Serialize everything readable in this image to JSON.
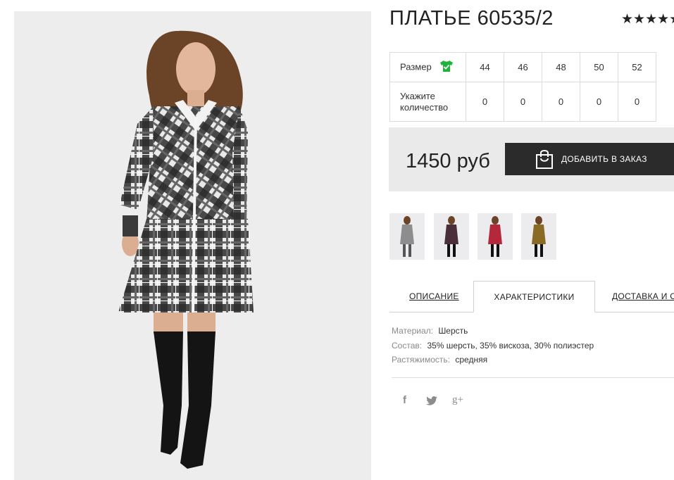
{
  "product": {
    "title": "ПЛАТЬЕ 60535/2",
    "rating_stars": "★★★★★",
    "price": "1450 руб",
    "add_button_label": "ДОБАВИТЬ В ЗАКАЗ"
  },
  "size_table": {
    "size_label": "Размер",
    "qty_label_line1": "Укажите",
    "qty_label_line2": "количество",
    "sizes": [
      "44",
      "46",
      "48",
      "50",
      "52"
    ],
    "quantities": [
      "0",
      "0",
      "0",
      "0",
      "0"
    ]
  },
  "thumbnails": [
    {
      "name": "grey-plaid",
      "color": "#8d8d8d"
    },
    {
      "name": "dark-plaid",
      "color": "#4a2f3a"
    },
    {
      "name": "red-plaid",
      "color": "#b5283c"
    },
    {
      "name": "mustard-plaid",
      "color": "#8a6a25"
    }
  ],
  "tabs": [
    {
      "label": "ОПИСАНИЕ"
    },
    {
      "label": "ХАРАКТЕРИСТИКИ"
    },
    {
      "label": "ДОСТАВКА И ОПЛАТА"
    }
  ],
  "specs": [
    {
      "key": "Материал:",
      "value": "Шерсть"
    },
    {
      "key": "Состав:",
      "value": "35% шерсть, 35% вискоза, 30% полиэстер"
    },
    {
      "key": "Растяжимость:",
      "value": "средняя"
    }
  ],
  "social": {
    "facebook": "f",
    "twitter": "twitter-bird",
    "googleplus": "g+"
  },
  "colors": {
    "accent_dark": "#2b2b2b",
    "size_icon_green": "#1fb33a",
    "panel_grey": "#eaeaea"
  }
}
